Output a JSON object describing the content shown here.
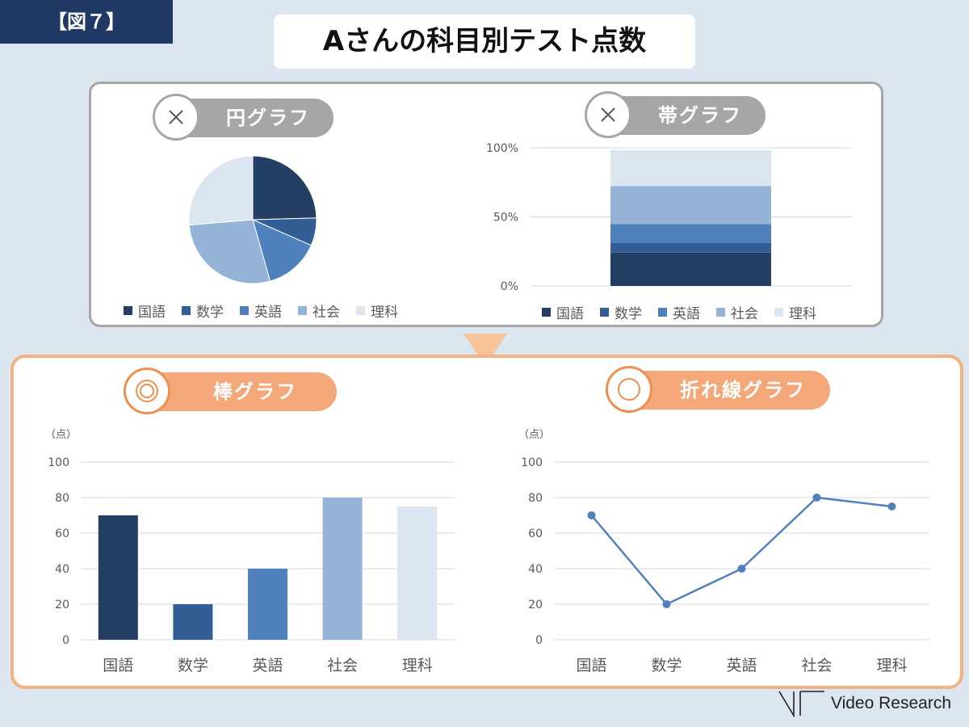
{
  "figure_tag": "【図７】",
  "title": "Aさんの科目別テスト点数",
  "colors": {
    "国語": "#243f63",
    "数学": "#335e95",
    "英語": "#4f81bd",
    "社会": "#95b3d7",
    "理科": "#dce6f1",
    "line": "#4f81bd"
  },
  "bad_examples": {
    "mark_icon": "cross-icon",
    "pie_label": "円グラフ",
    "stacked_label": "帯グラフ"
  },
  "good_examples": {
    "mark_icon": "double-circle-icon",
    "bar_label": "棒グラフ",
    "line_label": "折れ線グラフ"
  },
  "logo_text": "Video Research",
  "chart_data": [
    {
      "type": "pie",
      "title": "円グラフ",
      "categories": [
        "国語",
        "数学",
        "英語",
        "社会",
        "理科"
      ],
      "values": [
        70,
        20,
        40,
        80,
        75
      ],
      "legend": "bottom"
    },
    {
      "type": "bar",
      "stacked": true,
      "title": "帯グラフ",
      "series": [
        {
          "name": "国語",
          "values": [
            24.1
          ]
        },
        {
          "name": "数学",
          "values": [
            6.9
          ]
        },
        {
          "name": "英語",
          "values": [
            13.8
          ]
        },
        {
          "name": "社会",
          "values": [
            27.6
          ]
        },
        {
          "name": "理科",
          "values": [
            25.9
          ]
        }
      ],
      "ylim": [
        0,
        100
      ],
      "yticks": [
        "0%",
        "50%",
        "100%"
      ],
      "grid": true,
      "legend": "bottom"
    },
    {
      "type": "bar",
      "title": "棒グラフ",
      "unit_label": "（点）",
      "categories": [
        "国語",
        "数学",
        "英語",
        "社会",
        "理科"
      ],
      "values": [
        70,
        20,
        40,
        80,
        75
      ],
      "ylim": [
        0,
        100
      ],
      "yticks": [
        "0",
        "20",
        "40",
        "60",
        "80",
        "100"
      ],
      "grid": true
    },
    {
      "type": "line",
      "title": "折れ線グラフ",
      "unit_label": "（点）",
      "categories": [
        "国語",
        "数学",
        "英語",
        "社会",
        "理科"
      ],
      "values": [
        70,
        20,
        40,
        80,
        75
      ],
      "ylim": [
        0,
        100
      ],
      "yticks": [
        "0",
        "20",
        "40",
        "60",
        "80",
        "100"
      ],
      "grid": true
    }
  ]
}
